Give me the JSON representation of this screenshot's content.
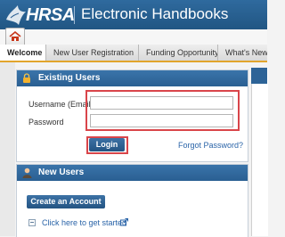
{
  "header": {
    "logo_text": "HRSA",
    "app_title": "Electronic Handbooks"
  },
  "nav": {
    "tabs": [
      {
        "label": "Welcome",
        "active": true
      },
      {
        "label": "New User Registration",
        "active": false
      },
      {
        "label": "Funding Opportunity",
        "active": false
      },
      {
        "label": "What's New",
        "active": false
      }
    ]
  },
  "existing_users": {
    "title": "Existing Users",
    "username_label": "Username (Email)",
    "username_value": "",
    "password_label": "Password",
    "password_value": "",
    "login_label": "Login",
    "forgot_label": "Forgot Password?"
  },
  "new_users": {
    "title": "New Users",
    "create_label": "Create an Account",
    "get_started_label": "Click here to get started"
  },
  "icons": {
    "home": "home-icon",
    "lock": "lock-icon",
    "user": "user-icon",
    "expand": "expand-icon",
    "external": "external-link-icon"
  },
  "colors": {
    "header_blue": "#215683",
    "accent_gold": "#e2a52c",
    "highlight_red": "#d9454a",
    "link_blue": "#2a64a8"
  }
}
